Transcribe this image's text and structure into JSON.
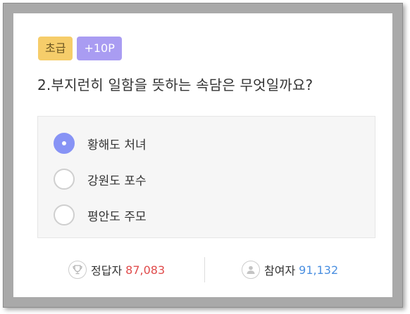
{
  "quiz": {
    "level_badge": "초급",
    "points_badge": "+10P",
    "question": "2.부지런히 일함을 뜻하는 속담은 무엇일까요?",
    "options": [
      {
        "label": "황해도 처녀",
        "selected": true
      },
      {
        "label": "강원도 포수",
        "selected": false
      },
      {
        "label": "평안도 주모",
        "selected": false
      }
    ]
  },
  "stats": {
    "correct_label": "정답자",
    "correct_count": "87,083",
    "participants_label": "참여자",
    "participants_count": "91,132"
  },
  "colors": {
    "level_badge": "#f6cd6a",
    "points_badge": "#a99cf2",
    "selected_radio": "#8793f5",
    "correct_count": "#e04b4b",
    "participants_count": "#4a8fe0"
  },
  "icons": {
    "correct": "trophy-icon",
    "participants": "person-icon"
  }
}
